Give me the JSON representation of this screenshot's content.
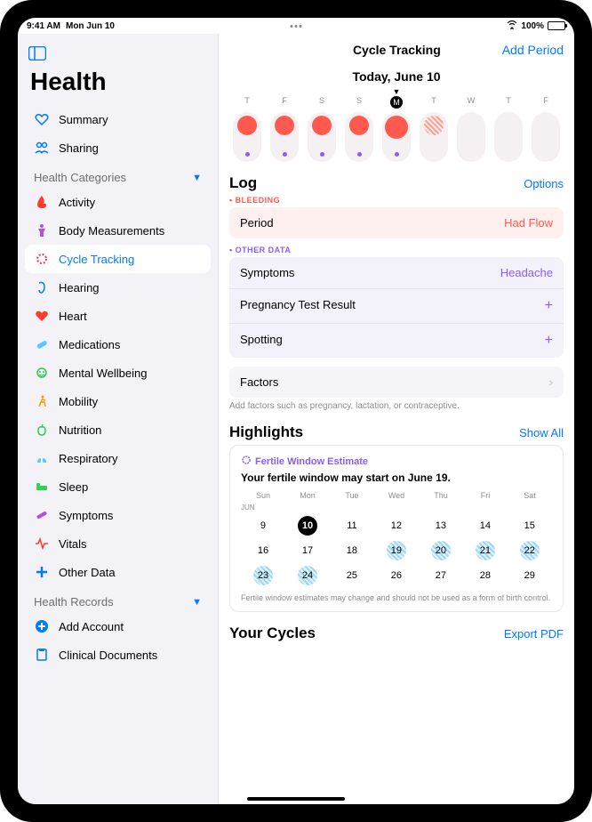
{
  "status": {
    "time": "9:41 AM",
    "date": "Mon Jun 10",
    "battery": "100%"
  },
  "sidebar": {
    "title": "Health",
    "top": [
      {
        "label": "Summary",
        "icon": "heart-outline",
        "color": "#007aff"
      },
      {
        "label": "Sharing",
        "icon": "people",
        "color": "#007aff"
      }
    ],
    "categoriesHeader": "Health Categories",
    "categories": [
      {
        "label": "Activity",
        "icon": "flame",
        "color": "#ff3b30"
      },
      {
        "label": "Body Measurements",
        "icon": "body",
        "color": "#af52de"
      },
      {
        "label": "Cycle Tracking",
        "icon": "cycle",
        "color": "#ff2d55"
      },
      {
        "label": "Hearing",
        "icon": "ear",
        "color": "#007aff"
      },
      {
        "label": "Heart",
        "icon": "heart",
        "color": "#ff3b30"
      },
      {
        "label": "Medications",
        "icon": "pills",
        "color": "#5ac8fa"
      },
      {
        "label": "Mental Wellbeing",
        "icon": "brain",
        "color": "#34c759"
      },
      {
        "label": "Mobility",
        "icon": "walk",
        "color": "#ff9500"
      },
      {
        "label": "Nutrition",
        "icon": "apple",
        "color": "#34c759"
      },
      {
        "label": "Respiratory",
        "icon": "lungs",
        "color": "#5ac8fa"
      },
      {
        "label": "Sleep",
        "icon": "bed",
        "color": "#30d158"
      },
      {
        "label": "Symptoms",
        "icon": "bandage",
        "color": "#af52de"
      },
      {
        "label": "Vitals",
        "icon": "vitals",
        "color": "#ff3b30"
      },
      {
        "label": "Other Data",
        "icon": "plus",
        "color": "#007aff"
      }
    ],
    "recordsHeader": "Health Records",
    "records": [
      {
        "label": "Add Account",
        "icon": "plus-circle",
        "color": "#007aff"
      },
      {
        "label": "Clinical Documents",
        "icon": "clipboard",
        "color": "#007aff"
      }
    ]
  },
  "content": {
    "title": "Cycle Tracking",
    "addPeriod": "Add Period",
    "today": "Today, June 10",
    "weekDays": [
      "T",
      "F",
      "S",
      "S",
      "M",
      "T",
      "W",
      "T",
      "F"
    ],
    "todayIndex": 4,
    "cycle": [
      {
        "period": true,
        "symptom": true
      },
      {
        "period": true,
        "symptom": true
      },
      {
        "period": true,
        "symptom": true
      },
      {
        "period": true,
        "symptom": true
      },
      {
        "period": true,
        "symptom": true,
        "big": true
      },
      {
        "hatched": true,
        "symptom": false
      },
      {
        "symptom": false
      },
      {
        "symptom": false
      },
      {
        "symptom": false
      }
    ],
    "log": {
      "title": "Log",
      "options": "Options",
      "bleedingLabel": "BLEEDING",
      "period": {
        "label": "Period",
        "value": "Had Flow"
      },
      "otherLabel": "OTHER DATA",
      "rows": [
        {
          "label": "Symptoms",
          "value": "Headache"
        },
        {
          "label": "Pregnancy Test Result",
          "plus": true
        },
        {
          "label": "Spotting",
          "plus": true
        }
      ],
      "factors": "Factors",
      "factorsHint": "Add factors such as pregnancy, lactation, or contraceptive."
    },
    "highlights": {
      "title": "Highlights",
      "showAll": "Show All",
      "fertileLabel": "Fertile Window Estimate",
      "fertileTitle": "Your fertile window may start on June 19.",
      "dayHeaders": [
        "Sun",
        "Mon",
        "Tue",
        "Wed",
        "Thu",
        "Fri",
        "Sat"
      ],
      "month": "JUN",
      "days": [
        9,
        10,
        11,
        12,
        13,
        14,
        15,
        16,
        17,
        18,
        19,
        20,
        21,
        22,
        23,
        24,
        25,
        26,
        27,
        28,
        29
      ],
      "today": 10,
      "fertile": [
        19,
        20,
        21,
        22,
        23,
        24
      ],
      "disclaimer": "Fertile window estimates may change and should not be used as a form of birth control."
    },
    "yourCycles": "Your Cycles",
    "exportPdf": "Export PDF"
  }
}
